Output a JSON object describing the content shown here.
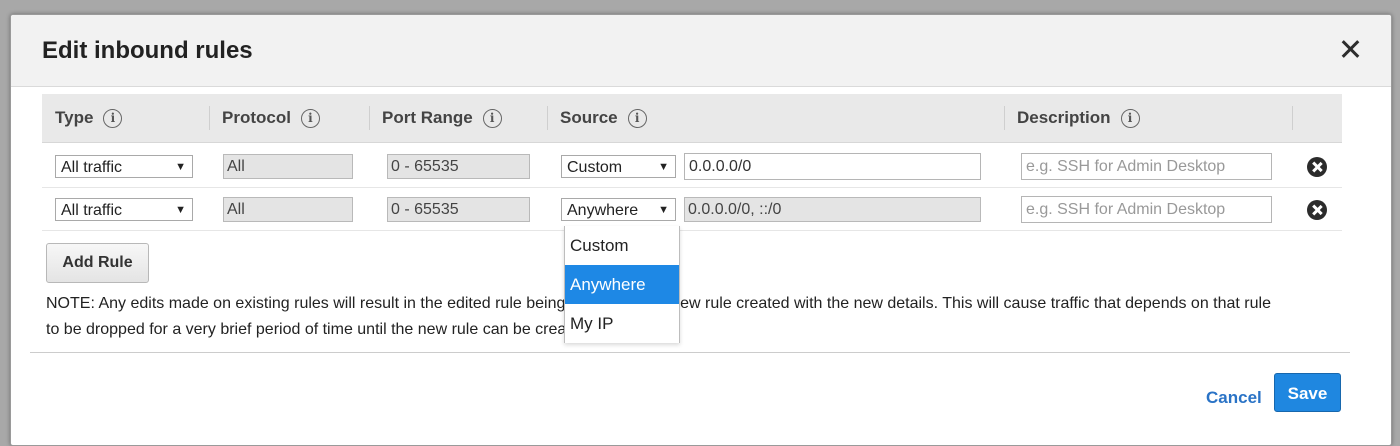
{
  "dialog": {
    "title": "Edit inbound rules"
  },
  "columns": [
    {
      "label": "Type"
    },
    {
      "label": "Protocol"
    },
    {
      "label": "Port Range"
    },
    {
      "label": "Source"
    },
    {
      "label": "Description"
    }
  ],
  "rules": [
    {
      "type": "All traffic",
      "protocol": "All",
      "port_range": "0 - 65535",
      "source_type": "Custom",
      "source_value": "0.0.0.0/0",
      "source_editable": true,
      "description_value": "",
      "description_placeholder": "e.g. SSH for Admin Desktop"
    },
    {
      "type": "All traffic",
      "protocol": "All",
      "port_range": "0 - 65535",
      "source_type": "Anywhere",
      "source_value": "0.0.0.0/0, ::/0",
      "source_editable": false,
      "description_value": "",
      "description_placeholder": "e.g. SSH for Admin Desktop"
    }
  ],
  "source_dropdown": {
    "options": [
      "Custom",
      "Anywhere",
      "My IP"
    ],
    "selected": "Anywhere"
  },
  "add_rule_label": "Add Rule",
  "note_text": "NOTE: Any edits made on existing rules will result in the edited rule being deleted and a new rule created with the new details. This will cause traffic that depends on that rule to be dropped for a very brief period of time until the new rule can be created.",
  "footer": {
    "cancel_label": "Cancel",
    "save_label": "Save"
  },
  "icons": {
    "info": "i",
    "caret": "▼"
  },
  "colors": {
    "primary": "#1f87e0",
    "link": "#2a73c6",
    "dropdown_selected": "#1e88e5"
  }
}
